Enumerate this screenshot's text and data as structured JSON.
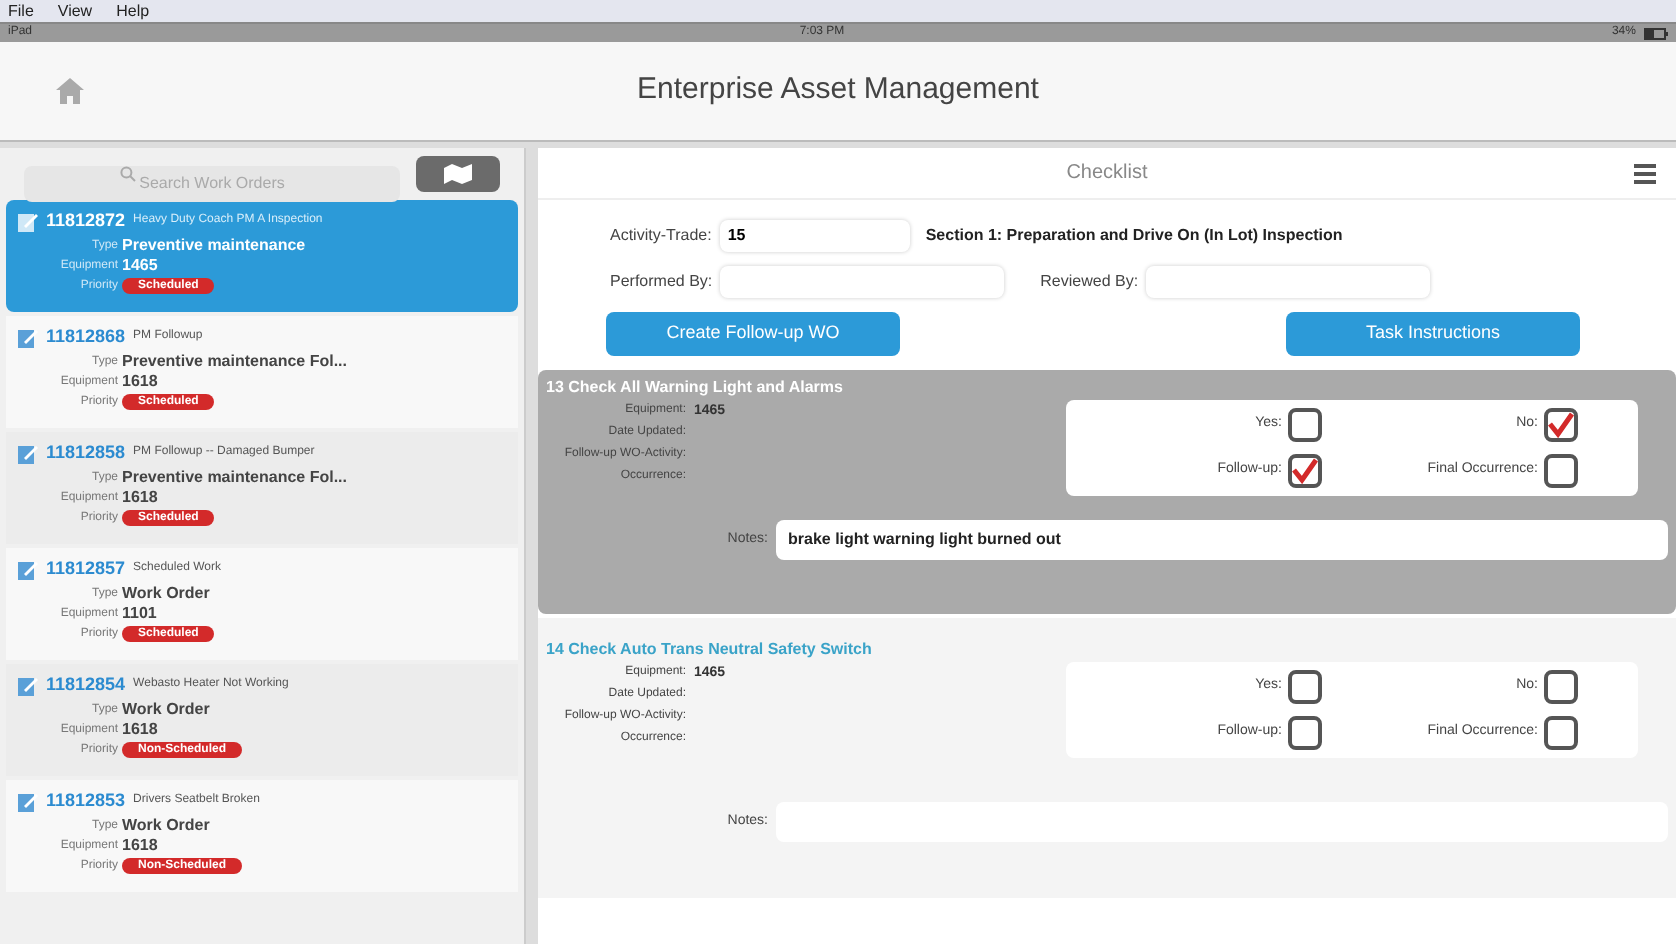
{
  "menu": [
    "File",
    "View",
    "Help"
  ],
  "status_bar": {
    "carrier": "iPad",
    "time": "7:03 PM",
    "battery": "34%"
  },
  "header": {
    "title": "Enterprise Asset Management"
  },
  "search": {
    "placeholder": "Search Work Orders"
  },
  "work_orders": [
    {
      "id": "11812872",
      "title": "Heavy Duty Coach PM A Inspection",
      "selected": true,
      "fields": [
        {
          "label": "Type",
          "value": "Preventive maintenance"
        },
        {
          "label": "Equipment",
          "value": "1465"
        }
      ],
      "priority_label": "Priority",
      "priority": "Scheduled"
    },
    {
      "id": "11812868",
      "title": "PM Followup",
      "selected": false,
      "fields": [
        {
          "label": "Type",
          "value": "Preventive maintenance Fol..."
        },
        {
          "label": "Equipment",
          "value": "1618"
        }
      ],
      "priority_label": "Priority",
      "priority": "Scheduled"
    },
    {
      "id": "11812858",
      "title": "PM Followup -- Damaged Bumper",
      "selected": false,
      "fields": [
        {
          "label": "Type",
          "value": "Preventive maintenance Fol..."
        },
        {
          "label": "Equipment",
          "value": "1618"
        }
      ],
      "priority_label": "Priority",
      "priority": "Scheduled"
    },
    {
      "id": "11812857",
      "title": "Scheduled Work",
      "selected": false,
      "fields": [
        {
          "label": "Type",
          "value": "Work Order"
        },
        {
          "label": "Equipment",
          "value": "1101"
        }
      ],
      "priority_label": "Priority",
      "priority": "Scheduled"
    },
    {
      "id": "11812854",
      "title": "Webasto Heater Not Working",
      "selected": false,
      "fields": [
        {
          "label": "Type",
          "value": "Work Order"
        },
        {
          "label": "Equipment",
          "value": "1618"
        }
      ],
      "priority_label": "Priority",
      "priority": "Non-Scheduled"
    },
    {
      "id": "11812853",
      "title": "Drivers Seatbelt Broken",
      "selected": false,
      "fields": [
        {
          "label": "Type",
          "value": "Work Order"
        },
        {
          "label": "Equipment",
          "value": "1618"
        }
      ],
      "priority_label": "Priority",
      "priority": "Non-Scheduled"
    }
  ],
  "checklist": {
    "title": "Checklist",
    "activity_trade": {
      "label": "Activity-Trade:",
      "value": "15"
    },
    "section": "Section 1:  Preparation and Drive On (In Lot) Inspection",
    "performed_by": {
      "label": "Performed By:"
    },
    "reviewed_by": {
      "label": "Reviewed By:"
    },
    "buttons": [
      "Create Follow-up WO",
      "Task Instructions"
    ],
    "tasks": [
      {
        "title": "13  Check All Warning Light and Alarms",
        "selected": true,
        "fields": [
          {
            "label": "Equipment:",
            "value": "1465"
          },
          {
            "label": "Date Updated:"
          },
          {
            "label": "Follow-up WO-Activity:"
          },
          {
            "label": "Occurrence:"
          }
        ],
        "checks": [
          {
            "label": "Yes:",
            "checked": false
          },
          {
            "label": "No:",
            "checked": true
          },
          {
            "label": "Follow-up:",
            "checked": true
          },
          {
            "label": "Final Occurrence:",
            "checked": false
          }
        ],
        "notes": {
          "label": "Notes:",
          "value": "brake light warning light burned out"
        }
      },
      {
        "title": "14  Check Auto Trans Neutral Safety Switch",
        "selected": false,
        "fields": [
          {
            "label": "Equipment:",
            "value": "1465"
          },
          {
            "label": "Date Updated:"
          },
          {
            "label": "Follow-up WO-Activity:"
          },
          {
            "label": "Occurrence:"
          }
        ],
        "checks": [
          {
            "label": "Yes:",
            "checked": false
          },
          {
            "label": "No:",
            "checked": false
          },
          {
            "label": "Follow-up:",
            "checked": false
          },
          {
            "label": "Final Occurrence:",
            "checked": false
          }
        ],
        "notes": {
          "label": "Notes:"
        }
      }
    ]
  }
}
